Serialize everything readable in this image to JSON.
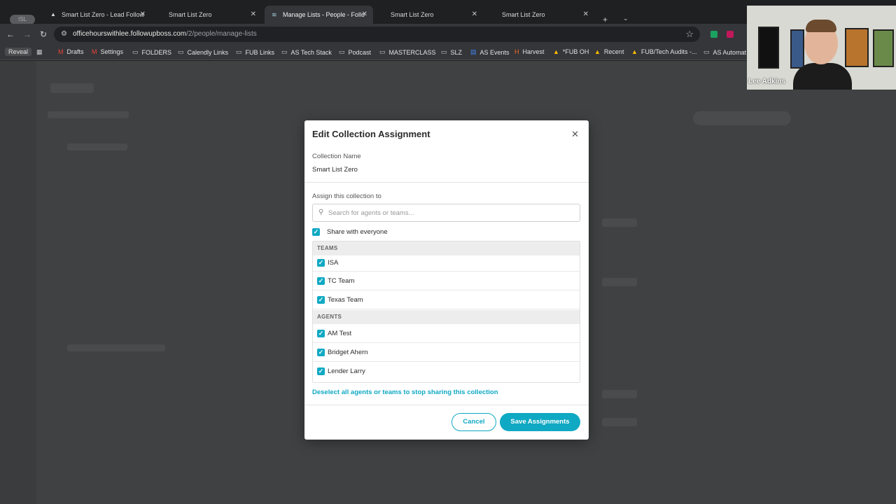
{
  "browser": {
    "profile_label": "ISL",
    "tabs": [
      {
        "title": "Smart List Zero - Lead Follow",
        "active": false
      },
      {
        "title": "Smart List Zero",
        "active": false
      },
      {
        "title": "Manage Lists - People - Follo",
        "active": true
      },
      {
        "title": "Smart List Zero",
        "active": false
      },
      {
        "title": "Smart List Zero",
        "active": false
      }
    ],
    "url_domain": "officehourswithlee.followupboss.com",
    "url_path": "/2/people/manage-lists",
    "bookmarks": [
      {
        "label": "Reveal",
        "icon": ""
      },
      {
        "label": "",
        "icon": "apps-grid-icon"
      },
      {
        "label": "Drafts",
        "icon": "gmail-icon"
      },
      {
        "label": "Settings",
        "icon": "gmail-icon"
      },
      {
        "label": "FOLDERS",
        "icon": "folder-icon"
      },
      {
        "label": "Calendly Links",
        "icon": "folder-icon"
      },
      {
        "label": "FUB Links",
        "icon": "folder-icon"
      },
      {
        "label": "AS Tech Stack",
        "icon": "folder-icon"
      },
      {
        "label": "Podcast",
        "icon": "folder-icon"
      },
      {
        "label": "MASTERCLASS",
        "icon": "folder-icon"
      },
      {
        "label": "SLZ",
        "icon": "folder-icon"
      },
      {
        "label": "AS Events",
        "icon": "doc-icon"
      },
      {
        "label": "Harvest",
        "icon": "harvest-icon"
      },
      {
        "label": "*FUB OH",
        "icon": "drive-icon"
      },
      {
        "label": "Recent",
        "icon": "drive-icon"
      },
      {
        "label": "FUB/Tech Audits -...",
        "icon": "drive-icon"
      },
      {
        "label": "AS Automat",
        "icon": "folder-icon"
      }
    ]
  },
  "modal": {
    "title": "Edit Collection Assignment",
    "collection_name_label": "Collection Name",
    "collection_name_value": "Smart List Zero",
    "assign_label": "Assign this collection to",
    "search_placeholder": "Search for agents or teams...",
    "share_with_everyone_label": "Share with everyone",
    "share_with_everyone_checked": true,
    "teams_header": "TEAMS",
    "teams": [
      {
        "label": "ISA",
        "checked": true
      },
      {
        "label": "TC Team",
        "checked": true
      },
      {
        "label": "Texas Team",
        "checked": true
      }
    ],
    "agents_header": "AGENTS",
    "agents": [
      {
        "label": "AM Test",
        "checked": true
      },
      {
        "label": "Bridget Ahern",
        "checked": true
      },
      {
        "label": "Lender Larry",
        "checked": true
      }
    ],
    "deselect_link": "Deselect all agents or teams to stop sharing this collection",
    "cancel_label": "Cancel",
    "save_label": "Save Assignments"
  },
  "video": {
    "participant_name": "Lee Adkins"
  },
  "colors": {
    "accent": "#10a9c3",
    "overlay": "#3f4142"
  }
}
